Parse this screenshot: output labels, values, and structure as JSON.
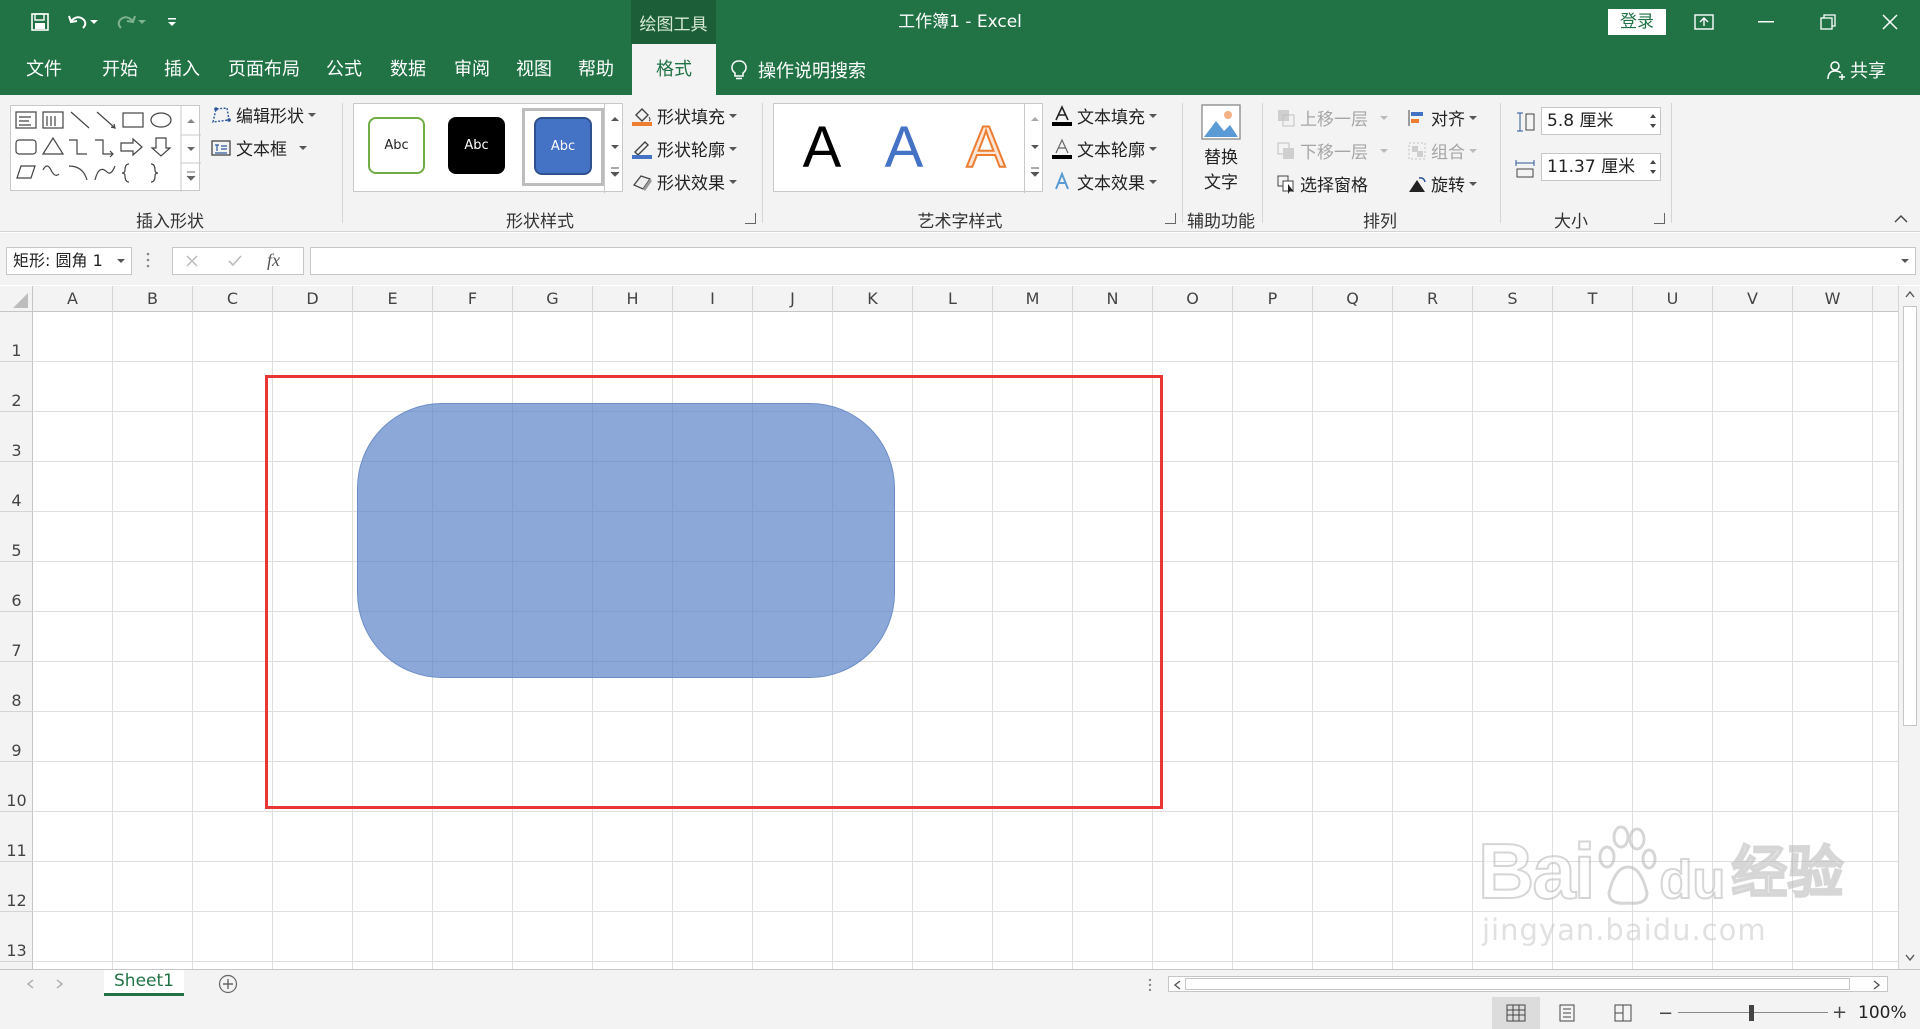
{
  "titlebar": {
    "title": "工作簿1  -  Excel",
    "context_tab": "绘图工具",
    "login": "登录"
  },
  "tabs": [
    {
      "label": "文件"
    },
    {
      "label": "开始"
    },
    {
      "label": "插入"
    },
    {
      "label": "页面布局"
    },
    {
      "label": "公式"
    },
    {
      "label": "数据"
    },
    {
      "label": "审阅"
    },
    {
      "label": "视图"
    },
    {
      "label": "帮助"
    },
    {
      "label": "格式",
      "active": true
    }
  ],
  "search": {
    "label": "操作说明搜索"
  },
  "share": {
    "label": "共享"
  },
  "ribbon": {
    "insert_shapes": {
      "label": "插入形状",
      "edit_shape": "编辑形状",
      "text_box": "文本框"
    },
    "shape_styles": {
      "label": "形状样式",
      "preset1": "Abc",
      "preset2": "Abc",
      "preset3": "Abc",
      "fill": "形状填充",
      "outline": "形状轮廓",
      "effects": "形状效果"
    },
    "wordart_styles": {
      "label": "艺术字样式",
      "letter": "A",
      "fill": "文本填充",
      "outline": "文本轮廓",
      "effects": "文本效果"
    },
    "accessibility": {
      "label": "辅助功能",
      "alt_text_line1": "替换",
      "alt_text_line2": "文字"
    },
    "arrange": {
      "label": "排列",
      "bring_forward": "上移一层",
      "send_backward": "下移一层",
      "selection_pane": "选择窗格",
      "align": "对齐",
      "group": "组合",
      "rotate": "旋转"
    },
    "size": {
      "label": "大小",
      "height": "5.8 厘米",
      "width": "11.37 厘米"
    }
  },
  "formula_bar": {
    "name_box": "矩形: 圆角 1",
    "fx": "fx",
    "value": ""
  },
  "columns": [
    "A",
    "B",
    "C",
    "D",
    "E",
    "F",
    "G",
    "H",
    "I",
    "J",
    "K",
    "L",
    "M",
    "N",
    "O",
    "P",
    "Q",
    "R",
    "S",
    "T",
    "U",
    "V",
    "W"
  ],
  "rows": [
    "1",
    "2",
    "3",
    "4",
    "5",
    "6",
    "7",
    "8",
    "9",
    "10",
    "11",
    "12",
    "13"
  ],
  "sheet_tabs": [
    {
      "label": "Sheet1",
      "active": true
    }
  ],
  "status": {
    "zoom": "100%"
  },
  "watermark": {
    "line1": "Bai",
    "line2": "du",
    "brand": "经验",
    "url": "jingyan.baidu.com"
  },
  "colors": {
    "accent": "#217346",
    "shape_fill": "#8aa8db",
    "highlight": "#e83535",
    "wordart_blue": "#4472c4",
    "wordart_orange": "#ed7d31"
  }
}
